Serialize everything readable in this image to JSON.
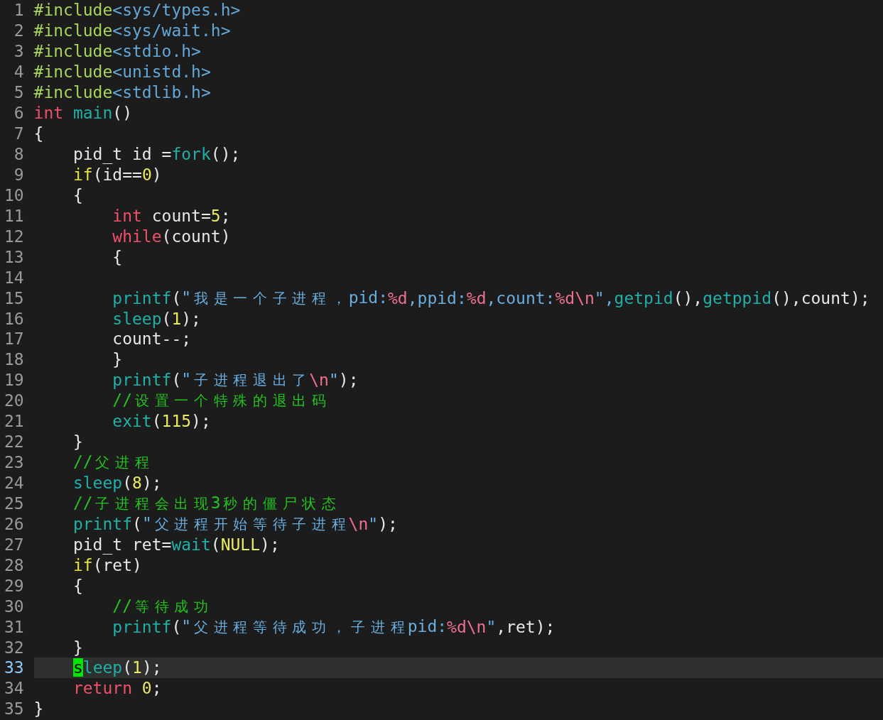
{
  "editor": {
    "lines": [
      {
        "number": "1",
        "current": false,
        "tokens": [
          {
            "kind": "preproc",
            "text": "#include"
          },
          {
            "kind": "header",
            "text": "<sys/types.h>"
          }
        ]
      },
      {
        "number": "2",
        "current": false,
        "tokens": [
          {
            "kind": "preproc",
            "text": "#include"
          },
          {
            "kind": "header",
            "text": "<sys/wait.h>"
          }
        ]
      },
      {
        "number": "3",
        "current": false,
        "tokens": [
          {
            "kind": "preproc",
            "text": "#include"
          },
          {
            "kind": "header",
            "text": "<stdio.h>"
          }
        ]
      },
      {
        "number": "4",
        "current": false,
        "tokens": [
          {
            "kind": "preproc",
            "text": "#include"
          },
          {
            "kind": "header",
            "text": "<unistd.h>"
          }
        ]
      },
      {
        "number": "5",
        "current": false,
        "tokens": [
          {
            "kind": "preproc",
            "text": "#include"
          },
          {
            "kind": "header",
            "text": "<stdlib.h>"
          }
        ]
      },
      {
        "number": "6",
        "current": false,
        "tokens": [
          {
            "kind": "keyword",
            "text": "int"
          },
          {
            "kind": "func",
            "text": " main"
          },
          {
            "kind": "plain",
            "text": "()"
          }
        ]
      },
      {
        "number": "7",
        "current": false,
        "tokens": [
          {
            "kind": "plain",
            "text": "{"
          }
        ]
      },
      {
        "number": "8",
        "current": false,
        "tokens": [
          {
            "kind": "plain",
            "text": "    pid_t id ="
          },
          {
            "kind": "func",
            "text": "fork"
          },
          {
            "kind": "plain",
            "text": "();"
          }
        ]
      },
      {
        "number": "9",
        "current": false,
        "tokens": [
          {
            "kind": "cond",
            "text": "    if"
          },
          {
            "kind": "plain",
            "text": "(id=="
          },
          {
            "kind": "number",
            "text": "0"
          },
          {
            "kind": "plain",
            "text": ")"
          }
        ]
      },
      {
        "number": "10",
        "current": false,
        "tokens": [
          {
            "kind": "plain",
            "text": "    {"
          }
        ]
      },
      {
        "number": "11",
        "current": false,
        "tokens": [
          {
            "kind": "keyword",
            "text": "        int"
          },
          {
            "kind": "plain",
            "text": " count="
          },
          {
            "kind": "number",
            "text": "5"
          },
          {
            "kind": "plain",
            "text": ";"
          }
        ]
      },
      {
        "number": "12",
        "current": false,
        "tokens": [
          {
            "kind": "keyword",
            "text": "        while"
          },
          {
            "kind": "plain",
            "text": "(count)"
          }
        ]
      },
      {
        "number": "13",
        "current": false,
        "tokens": [
          {
            "kind": "plain",
            "text": "        {"
          }
        ]
      },
      {
        "number": "14",
        "current": false
      },
      {
        "number": "15",
        "current": false,
        "tokens": [
          {
            "kind": "func",
            "text": "        printf"
          },
          {
            "kind": "plain",
            "text": "("
          },
          {
            "kind": "string",
            "text": "\"我是一个子进程，pid:"
          },
          {
            "kind": "escape",
            "text": "%d"
          },
          {
            "kind": "string",
            "text": ",ppid:"
          },
          {
            "kind": "escape",
            "text": "%d"
          },
          {
            "kind": "string",
            "text": ",count:"
          },
          {
            "kind": "escape",
            "text": "%d\\n"
          },
          {
            "kind": "string",
            "text": "\","
          },
          {
            "kind": "func",
            "text": "getpid"
          },
          {
            "kind": "plain",
            "text": "(),"
          },
          {
            "kind": "func",
            "text": "getppid"
          },
          {
            "kind": "plain",
            "text": "(),count);"
          }
        ]
      },
      {
        "number": "16",
        "current": false,
        "tokens": [
          {
            "kind": "func",
            "text": "        sleep"
          },
          {
            "kind": "plain",
            "text": "("
          },
          {
            "kind": "number",
            "text": "1"
          },
          {
            "kind": "plain",
            "text": ");"
          }
        ]
      },
      {
        "number": "17",
        "current": false,
        "tokens": [
          {
            "kind": "plain",
            "text": "        count--;"
          }
        ]
      },
      {
        "number": "18",
        "current": false,
        "tokens": [
          {
            "kind": "plain",
            "text": "        }"
          }
        ]
      },
      {
        "number": "19",
        "current": false,
        "tokens": [
          {
            "kind": "func",
            "text": "        printf"
          },
          {
            "kind": "plain",
            "text": "("
          },
          {
            "kind": "string",
            "text": "\"子进程退出了"
          },
          {
            "kind": "escape",
            "text": "\\n"
          },
          {
            "kind": "string",
            "text": "\""
          },
          {
            "kind": "plain",
            "text": ");"
          }
        ]
      },
      {
        "number": "20",
        "current": false,
        "tokens": [
          {
            "kind": "comment",
            "text": "        //设置一个特殊的退出码"
          }
        ]
      },
      {
        "number": "21",
        "current": false,
        "tokens": [
          {
            "kind": "func",
            "text": "        exit"
          },
          {
            "kind": "plain",
            "text": "("
          },
          {
            "kind": "number",
            "text": "115"
          },
          {
            "kind": "plain",
            "text": ");"
          }
        ]
      },
      {
        "number": "22",
        "current": false,
        "tokens": [
          {
            "kind": "plain",
            "text": "    }"
          }
        ]
      },
      {
        "number": "23",
        "current": false,
        "tokens": [
          {
            "kind": "comment",
            "text": "    //父进程"
          }
        ]
      },
      {
        "number": "24",
        "current": false,
        "tokens": [
          {
            "kind": "func",
            "text": "    sleep"
          },
          {
            "kind": "plain",
            "text": "("
          },
          {
            "kind": "number",
            "text": "8"
          },
          {
            "kind": "plain",
            "text": ");"
          }
        ]
      },
      {
        "number": "25",
        "current": false,
        "tokens": [
          {
            "kind": "comment",
            "text": "    //子进程会出现3秒的僵尸状态"
          }
        ]
      },
      {
        "number": "26",
        "current": false,
        "tokens": [
          {
            "kind": "func",
            "text": "    printf"
          },
          {
            "kind": "plain",
            "text": "("
          },
          {
            "kind": "string",
            "text": "\"父进程开始等待子进程"
          },
          {
            "kind": "escape",
            "text": "\\n"
          },
          {
            "kind": "string",
            "text": "\""
          },
          {
            "kind": "plain",
            "text": ");"
          }
        ]
      },
      {
        "number": "27",
        "current": false,
        "tokens": [
          {
            "kind": "plain",
            "text": "    pid_t ret="
          },
          {
            "kind": "func",
            "text": "wait"
          },
          {
            "kind": "plain",
            "text": "("
          },
          {
            "kind": "number",
            "text": "NULL"
          },
          {
            "kind": "plain",
            "text": ");"
          }
        ]
      },
      {
        "number": "28",
        "current": false,
        "tokens": [
          {
            "kind": "cond",
            "text": "    if"
          },
          {
            "kind": "plain",
            "text": "(ret)"
          }
        ]
      },
      {
        "number": "29",
        "current": false,
        "tokens": [
          {
            "kind": "plain",
            "text": "    {"
          }
        ]
      },
      {
        "number": "30",
        "current": false,
        "tokens": [
          {
            "kind": "comment",
            "text": "        //等待成功"
          }
        ]
      },
      {
        "number": "31",
        "current": false,
        "tokens": [
          {
            "kind": "func",
            "text": "        printf"
          },
          {
            "kind": "plain",
            "text": "("
          },
          {
            "kind": "string",
            "text": "\"父进程等待成功，子进程pid:"
          },
          {
            "kind": "escape",
            "text": "%d\\n"
          },
          {
            "kind": "string",
            "text": "\""
          },
          {
            "kind": "plain",
            "text": ",ret);"
          }
        ]
      },
      {
        "number": "32",
        "current": false,
        "tokens": [
          {
            "kind": "plain",
            "text": "    }"
          }
        ]
      },
      {
        "number": "33",
        "current": true,
        "tokens": [
          {
            "kind": "cursor",
            "text": "    s"
          },
          {
            "kind": "func",
            "text": "leep"
          },
          {
            "kind": "plain",
            "text": "("
          },
          {
            "kind": "number",
            "text": "1"
          },
          {
            "kind": "plain",
            "text": ");"
          }
        ]
      },
      {
        "number": "34",
        "current": false,
        "tokens": [
          {
            "kind": "keyword",
            "text": "    return"
          },
          {
            "kind": "number",
            "text": " 0"
          },
          {
            "kind": "plain",
            "text": ";"
          }
        ]
      },
      {
        "number": "35",
        "current": false,
        "tokens": [
          {
            "kind": "plain",
            "text": "}"
          }
        ]
      }
    ]
  }
}
